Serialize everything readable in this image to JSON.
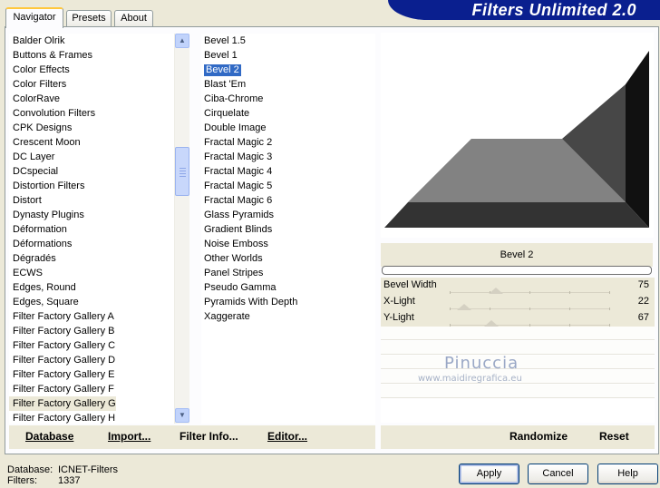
{
  "app": {
    "title": "Filters Unlimited 2.0"
  },
  "tabs": [
    "Navigator",
    "Presets",
    "About"
  ],
  "categories": {
    "items": [
      "Balder Olrik",
      "Buttons & Frames",
      "Color Effects",
      "Color Filters",
      "ColorRave",
      "Convolution Filters",
      "CPK Designs",
      "Crescent Moon",
      "DC Layer",
      "DCspecial",
      "Distortion Filters",
      "Distort",
      "Dynasty Plugins",
      "Déformation",
      "Déformations",
      "Dégradés",
      "ECWS",
      "Edges, Round",
      "Edges, Square",
      "Filter Factory Gallery A",
      "Filter Factory Gallery B",
      "Filter Factory Gallery C",
      "Filter Factory Gallery D",
      "Filter Factory Gallery E",
      "Filter Factory Gallery F",
      "Filter Factory Gallery G",
      "Filter Factory Gallery H"
    ],
    "selected": "Filter Factory Gallery G"
  },
  "filters": {
    "items": [
      "Bevel 1.5",
      "Bevel 1",
      "Bevel 2",
      "Blast 'Em",
      "Ciba-Chrome",
      "Cirquelate",
      "Double Image",
      "Fractal Magic 2",
      "Fractal Magic 3",
      "Fractal Magic 4",
      "Fractal Magic 5",
      "Fractal Magic 6",
      "Glass Pyramids",
      "Gradient Blinds",
      "Noise Emboss",
      "Other Worlds",
      "Panel Stripes",
      "Pseudo Gamma",
      "Pyramids With Depth",
      "Xaggerate"
    ],
    "selected": "Bevel 2"
  },
  "preview": {
    "filter_title": "Bevel 2"
  },
  "params": [
    {
      "name": "Bevel Width",
      "value": "75",
      "level": 0.29
    },
    {
      "name": "X-Light",
      "value": "22",
      "level": 0.09
    },
    {
      "name": "Y-Light",
      "value": "67",
      "level": 0.26
    }
  ],
  "watermark": {
    "name": "Pinuccia",
    "url": "www.maidiregrafica.eu"
  },
  "left_bar": {
    "database": "Database",
    "import": "Import...",
    "filter_info": "Filter Info...",
    "editor": "Editor..."
  },
  "right_bar": {
    "randomize": "Randomize",
    "reset": "Reset"
  },
  "info": {
    "database_label": "Database:",
    "database_value": "ICNET-Filters",
    "filters_label": "Filters:",
    "filters_value": "1337"
  },
  "buttons": {
    "apply": "Apply",
    "cancel": "Cancel",
    "help": "Help"
  },
  "colors": {
    "selection": "#316ac5",
    "banner": "#0a1f8f",
    "window_bg": "#ece9d8"
  }
}
